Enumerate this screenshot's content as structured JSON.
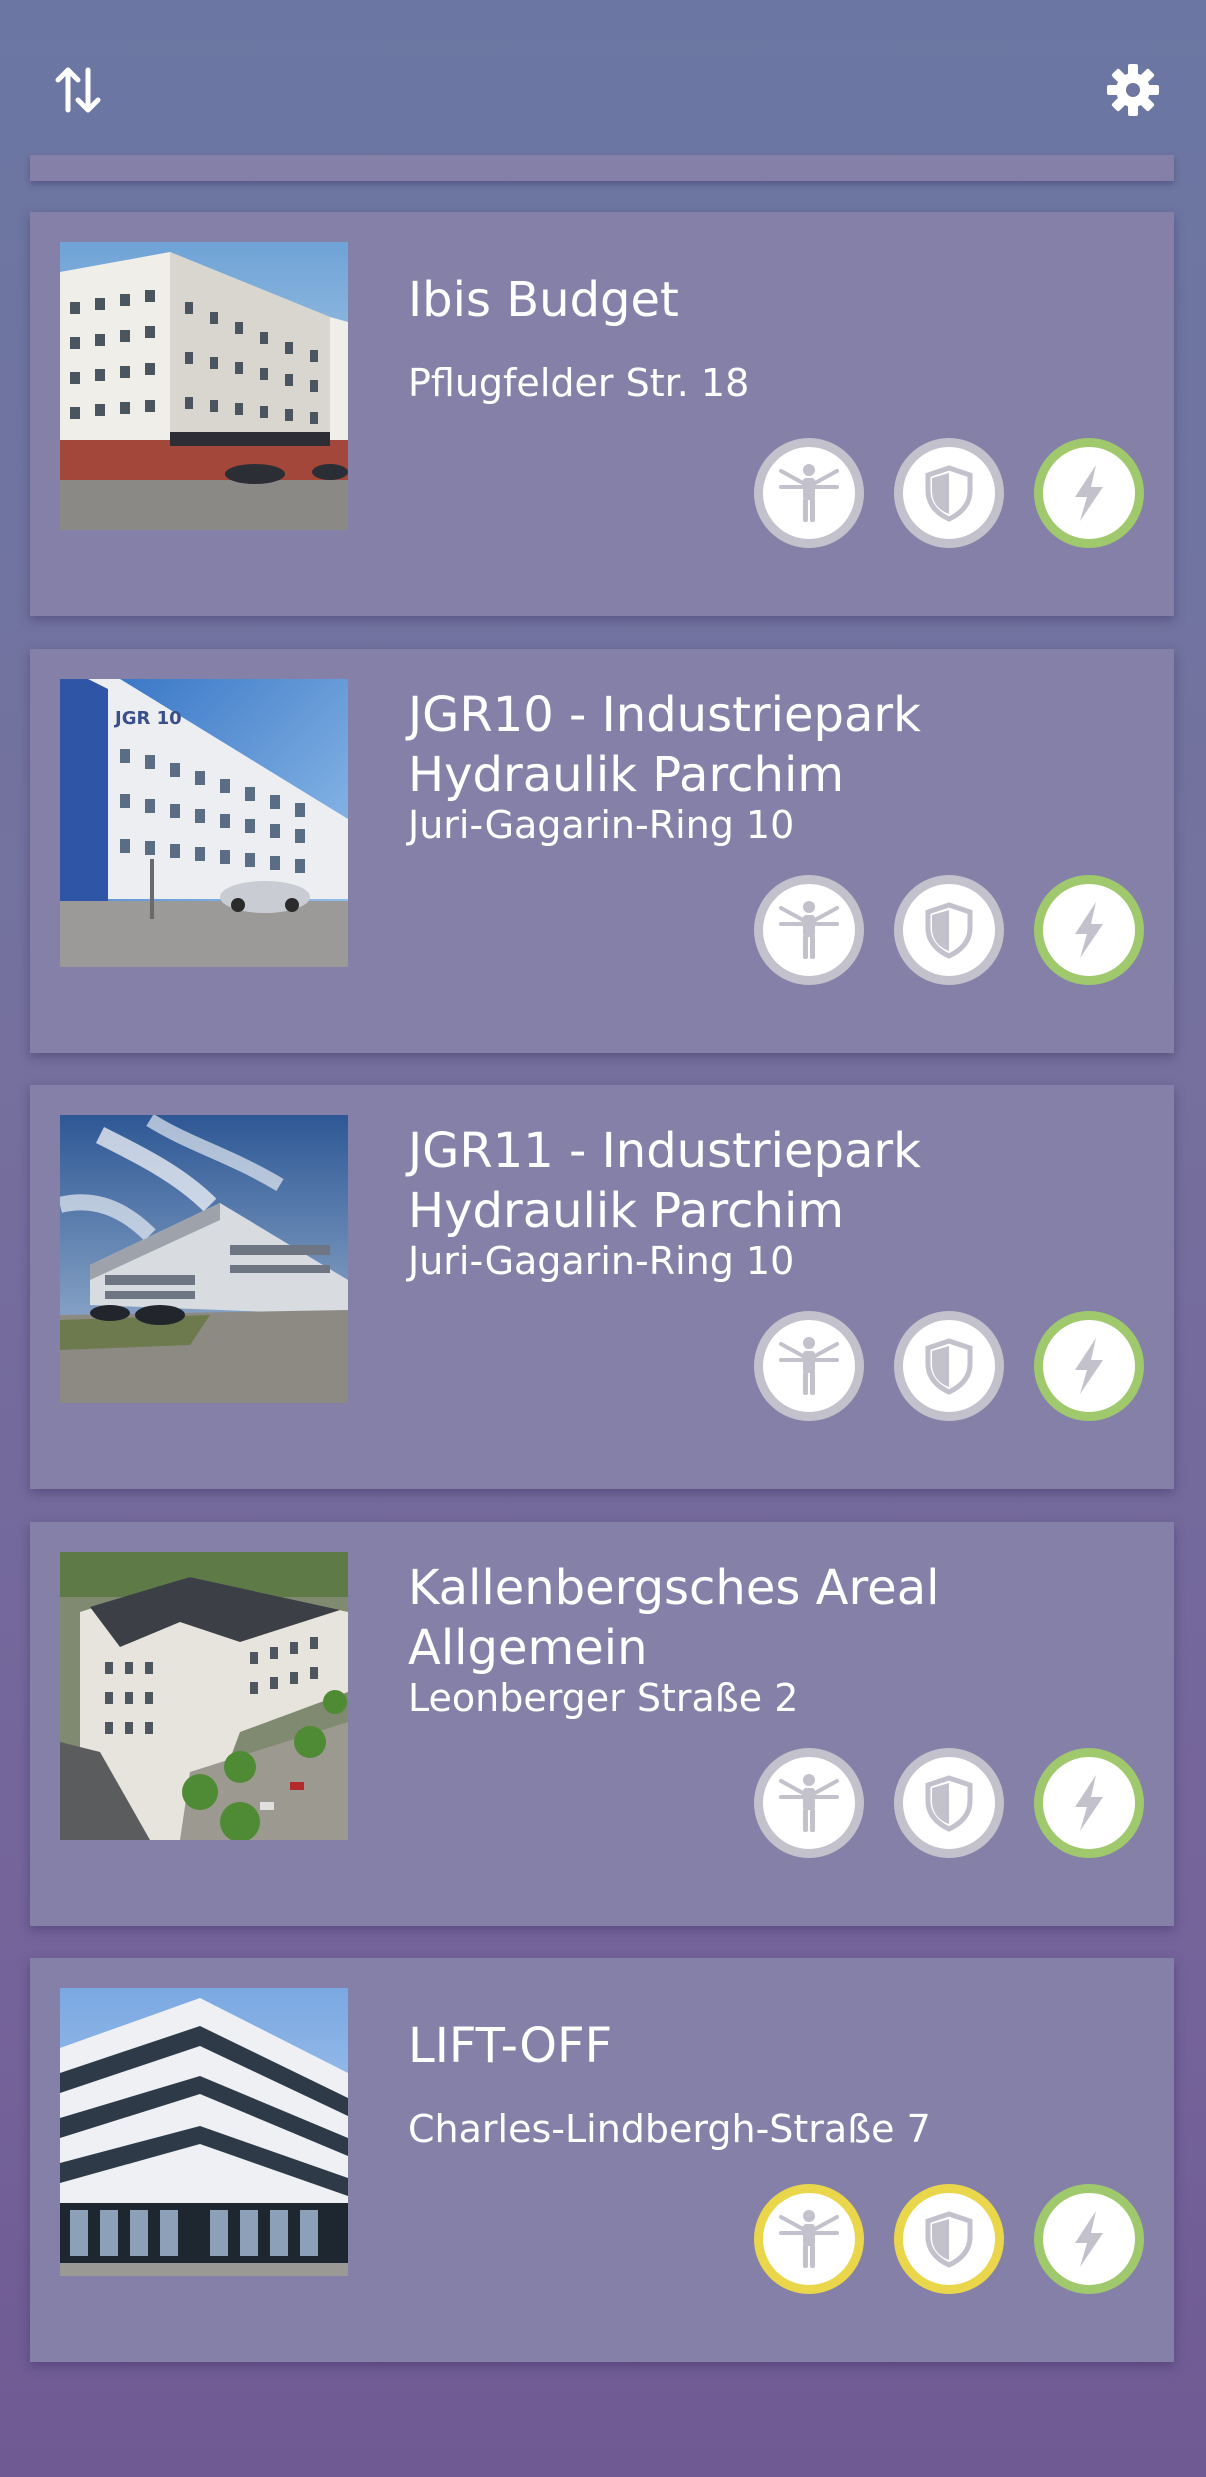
{
  "toolbar": {
    "sort_icon": "sort-arrows-icon",
    "settings_icon": "gear-icon"
  },
  "colors": {
    "card_background": "#8580a8",
    "status_grey": "#c3c1cb",
    "status_green": "#9fc96c",
    "status_yellow": "#ead64a"
  },
  "sites": [
    {
      "title": "Ibis Budget",
      "address": "Pflugfelder Str. 18",
      "status": {
        "person": "grey",
        "shield": "grey",
        "energy": "green"
      }
    },
    {
      "title": "JGR10 - Industriepark Hydraulik Parchim",
      "address": "Juri-Gagarin-Ring 10",
      "status": {
        "person": "grey",
        "shield": "grey",
        "energy": "green"
      }
    },
    {
      "title": "JGR11 - Industriepark Hydraulik Parchim",
      "address": "Juri-Gagarin-Ring 10",
      "status": {
        "person": "grey",
        "shield": "grey",
        "energy": "green"
      }
    },
    {
      "title": "Kallenbergsches Areal Allgemein",
      "address": "Leonberger Straße 2",
      "status": {
        "person": "grey",
        "shield": "grey",
        "energy": "green"
      }
    },
    {
      "title": "LIFT-OFF",
      "address": "Charles-Lindbergh-Straße 7",
      "status": {
        "person": "yellow",
        "shield": "yellow",
        "energy": "green"
      }
    }
  ]
}
